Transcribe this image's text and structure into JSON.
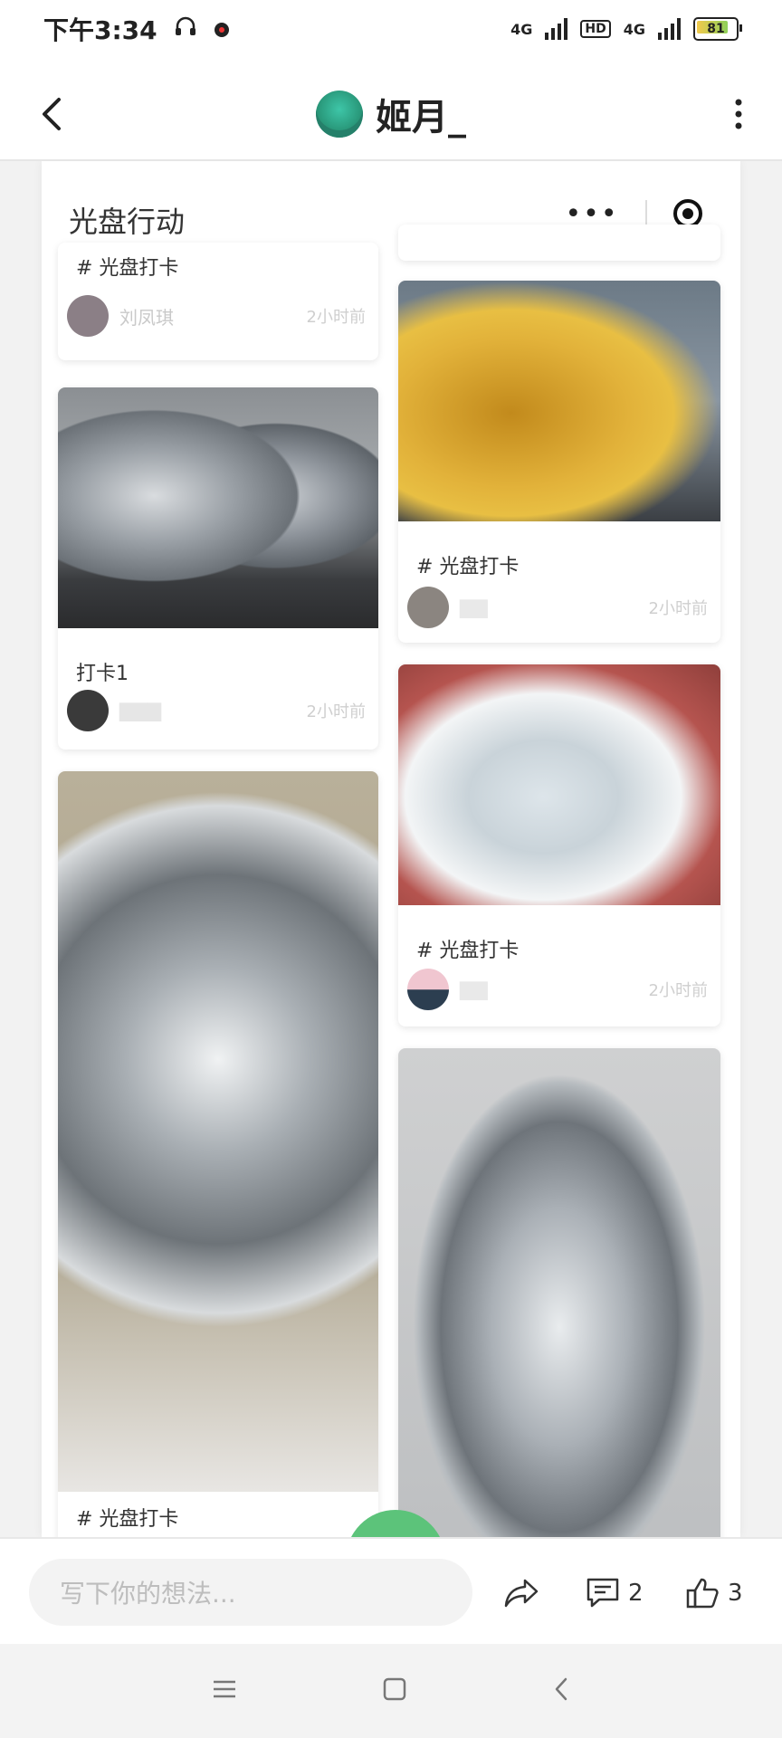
{
  "status_bar": {
    "time": "下午3:34",
    "network_1": "4G",
    "hd_label": "HD",
    "network_2": "4G",
    "battery": "81"
  },
  "header": {
    "title": "姬月_"
  },
  "mini_program": {
    "title": "光盘行动",
    "cards": [
      {
        "caption": "# 光盘打卡",
        "name": "刘凤琪",
        "time": "2小时前"
      },
      {
        "caption": "打卡1",
        "time": "2小时前"
      },
      {
        "caption": "# 光盘打卡"
      },
      {
        "caption": "# 光盘打卡",
        "time": "2小时前"
      },
      {
        "caption": "# 光盘打卡",
        "time": "2小时前"
      }
    ]
  },
  "bottom_bar": {
    "input_placeholder": "写下你的想法...",
    "comment_count": "2",
    "like_count": "3"
  },
  "colors": {
    "accent_green": "#5cc37a"
  },
  "icons": [
    "back-arrow-icon",
    "more-vertical-icon",
    "share-icon",
    "comment-icon",
    "like-icon",
    "menu-icon",
    "home-icon",
    "nav-back-icon"
  ]
}
